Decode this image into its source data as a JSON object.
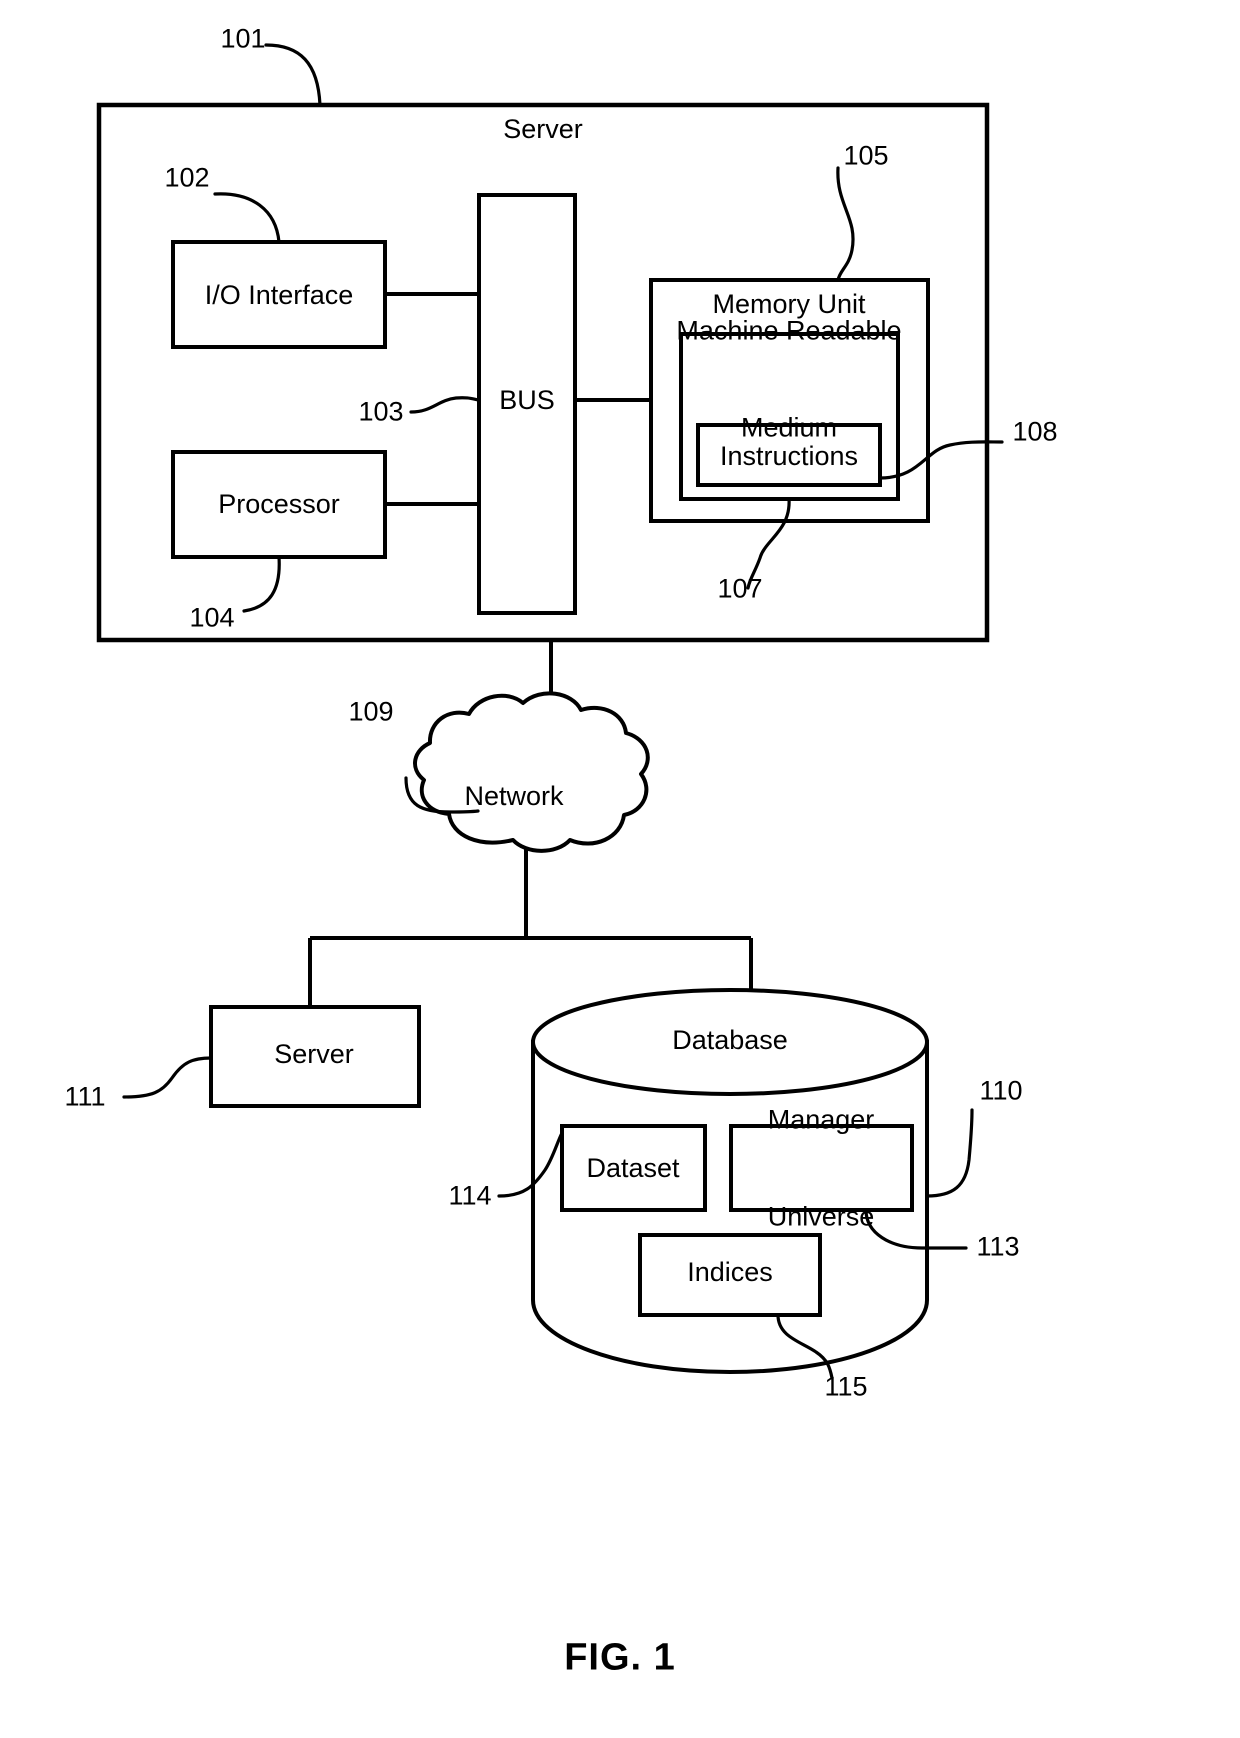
{
  "figure": {
    "caption": "FIG. 1",
    "title_node": "Server"
  },
  "nodes": {
    "server_outer": {
      "label": "Server",
      "ref": "101"
    },
    "io_interface": {
      "label": "I/O Interface",
      "ref": "102"
    },
    "bus": {
      "label": "BUS",
      "ref": "103"
    },
    "processor": {
      "label": "Processor",
      "ref": "104"
    },
    "memory_unit": {
      "label": "Memory Unit",
      "ref": "105"
    },
    "machine_readable_medium": {
      "label": "Machine Readable\nMedium",
      "ref": "107"
    },
    "instructions": {
      "label": "Instructions",
      "ref": "108"
    },
    "network": {
      "label": "Network",
      "ref": "109"
    },
    "database": {
      "label": "Database",
      "ref": "110"
    },
    "server_remote": {
      "label": "Server",
      "ref": "111"
    },
    "manager_universe": {
      "label": "Manager\nUniverse",
      "ref": "113"
    },
    "dataset": {
      "label": "Dataset",
      "ref": "114"
    },
    "indices": {
      "label": "Indices",
      "ref": "115"
    }
  },
  "reference_numerals": [
    {
      "id": "101",
      "text": "101"
    },
    {
      "id": "102",
      "text": "102"
    },
    {
      "id": "103",
      "text": "103"
    },
    {
      "id": "104",
      "text": "104"
    },
    {
      "id": "105",
      "text": "105"
    },
    {
      "id": "107",
      "text": "107"
    },
    {
      "id": "108",
      "text": "108"
    },
    {
      "id": "109",
      "text": "109"
    },
    {
      "id": "110",
      "text": "110"
    },
    {
      "id": "111",
      "text": "111"
    },
    {
      "id": "113",
      "text": "113"
    },
    {
      "id": "114",
      "text": "114"
    },
    {
      "id": "115",
      "text": "115"
    }
  ],
  "node_labels": {
    "machine_readable_medium_line1": "Machine Readable",
    "machine_readable_medium_line2": "Medium",
    "manager_universe_line1": "Manager",
    "manager_universe_line2": "Universe"
  },
  "colors": {
    "stroke": "#000000",
    "background": "#ffffff"
  }
}
